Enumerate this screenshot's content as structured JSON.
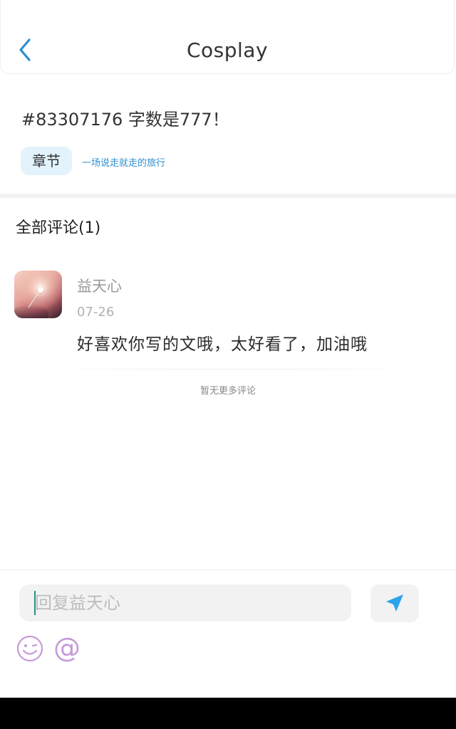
{
  "header": {
    "title": "Cosplay",
    "back_icon": "chevron-left-icon",
    "accent_color": "#2b8fd3"
  },
  "post": {
    "title": "#83307176 字数是777！",
    "tag_label": "章节",
    "chapter_link": "一场说走就走的旅行"
  },
  "comments": {
    "heading": "全部评论(1)",
    "items": [
      {
        "author": "益天心",
        "date": "07-26",
        "text": "好喜欢你写的文哦，太好看了，加油哦"
      }
    ],
    "no_more": "暂无更多评论"
  },
  "reply_bar": {
    "placeholder": "回复益天心",
    "send_icon": "send-icon",
    "emoji_icon": "emoji-icon",
    "at_symbol": "@",
    "send_color": "#2aa4ea",
    "tool_color": "#c89ad9"
  }
}
